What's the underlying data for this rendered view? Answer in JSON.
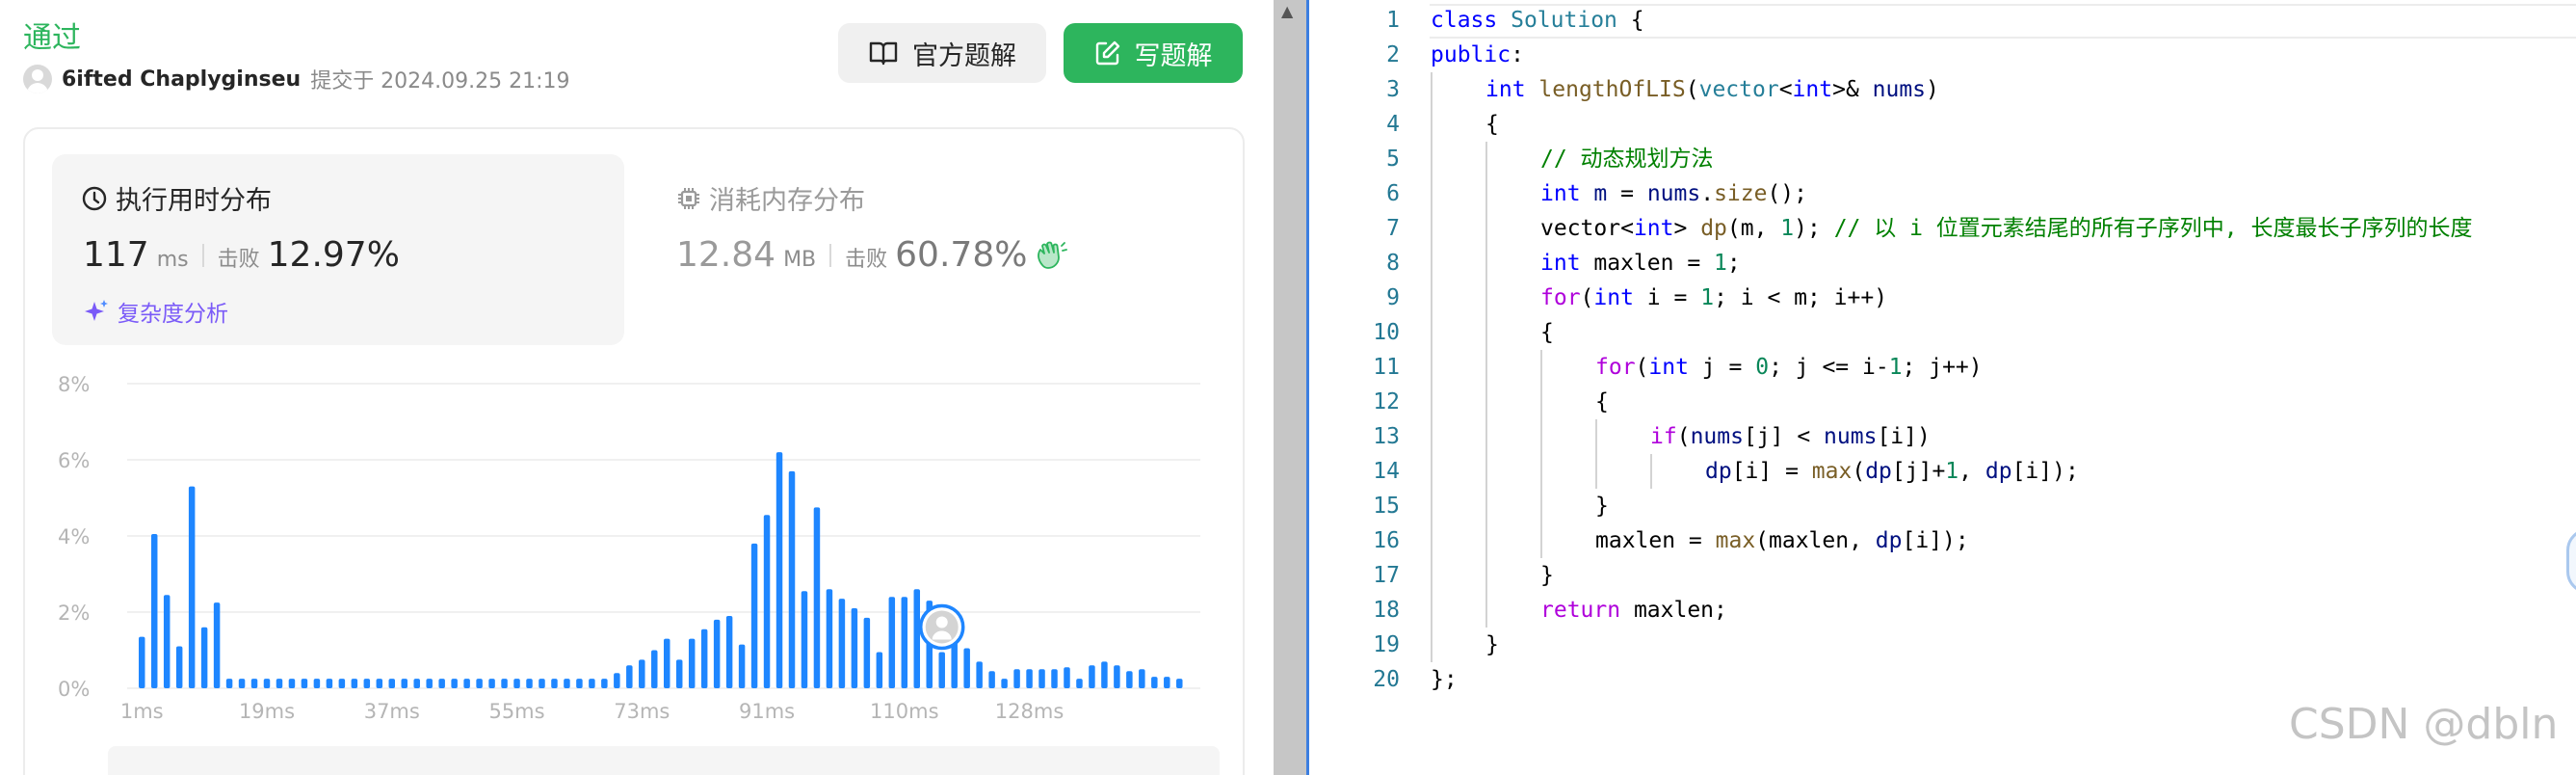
{
  "submission": {
    "status": "通过",
    "user": "6ifted Chaplyginseu",
    "submitted_text": "提交于 2024.09.25 21:19"
  },
  "buttons": {
    "official": "官方题解",
    "write": "写题解"
  },
  "runtime": {
    "title": "执行用时分布",
    "value": "117",
    "unit": "ms",
    "beat_label": "击败",
    "beat_pct": "12.97%",
    "analysis": "复杂度分析"
  },
  "memory": {
    "title": "消耗内存分布",
    "value": "12.84",
    "unit": "MB",
    "beat_label": "击败",
    "beat_pct": "60.78%"
  },
  "colors": {
    "accent_green": "#2db55d",
    "bar_blue": "#1e86ff",
    "analysis_purple": "#7a5af8"
  },
  "chart_data": {
    "type": "bar",
    "ylim": [
      0,
      8
    ],
    "y_ticks": [
      "0%",
      "2%",
      "4%",
      "6%",
      "8%"
    ],
    "x_ticks": [
      "1ms",
      "19ms",
      "37ms",
      "55ms",
      "73ms",
      "91ms",
      "110ms",
      "128ms"
    ],
    "values": [
      1.35,
      4.05,
      2.45,
      1.1,
      5.3,
      1.6,
      2.25,
      0.25,
      0.25,
      0.25,
      0.25,
      0.25,
      0.25,
      0.25,
      0.25,
      0.25,
      0.25,
      0.25,
      0.25,
      0.25,
      0.25,
      0.25,
      0.25,
      0.25,
      0.25,
      0.25,
      0.25,
      0.25,
      0.25,
      0.25,
      0.25,
      0.25,
      0.25,
      0.25,
      0.25,
      0.25,
      0.25,
      0.25,
      0.4,
      0.6,
      0.75,
      1.0,
      1.3,
      0.75,
      1.3,
      1.55,
      1.8,
      1.9,
      1.15,
      3.8,
      4.55,
      6.2,
      5.7,
      2.55,
      4.75,
      2.6,
      2.35,
      2.1,
      1.85,
      0.95,
      2.4,
      2.4,
      2.6,
      2.3,
      0.95,
      1.55,
      1.05,
      0.7,
      0.45,
      0.25,
      0.5,
      0.5,
      0.5,
      0.5,
      0.55,
      0.25,
      0.6,
      0.7,
      0.6,
      0.45,
      0.5,
      0.3,
      0.3,
      0.25
    ],
    "highlight_value": "117ms",
    "grid": true
  },
  "code": {
    "lines": [
      {
        "n": "1",
        "indent": 0,
        "tokens": [
          [
            "kw",
            "class"
          ],
          [
            "t",
            " "
          ],
          [
            "ty",
            "Solution"
          ],
          [
            "t",
            " {"
          ]
        ]
      },
      {
        "n": "2",
        "indent": 0,
        "tokens": [
          [
            "kw",
            "public"
          ],
          [
            "t",
            ":"
          ]
        ]
      },
      {
        "n": "3",
        "indent": 1,
        "tokens": [
          [
            "kw",
            "int"
          ],
          [
            "t",
            " "
          ],
          [
            "fn",
            "lengthOfLIS"
          ],
          [
            "t",
            "("
          ],
          [
            "ty",
            "vector"
          ],
          [
            "t",
            "<"
          ],
          [
            "kw",
            "int"
          ],
          [
            "t",
            ">& "
          ],
          [
            "vr",
            "nums"
          ],
          [
            "t",
            ")"
          ]
        ]
      },
      {
        "n": "4",
        "indent": 1,
        "tokens": [
          [
            "t",
            "{"
          ]
        ]
      },
      {
        "n": "5",
        "indent": 2,
        "tokens": [
          [
            "cm",
            "// 动态规划方法"
          ]
        ]
      },
      {
        "n": "6",
        "indent": 2,
        "tokens": [
          [
            "kw",
            "int"
          ],
          [
            "t",
            " "
          ],
          [
            "vr",
            "m"
          ],
          [
            "t",
            " = "
          ],
          [
            "vr",
            "nums"
          ],
          [
            "t",
            "."
          ],
          [
            "fn",
            "size"
          ],
          [
            "t",
            "();"
          ]
        ]
      },
      {
        "n": "7",
        "indent": 2,
        "tokens": [
          [
            "t",
            "vector<"
          ],
          [
            "kw",
            "int"
          ],
          [
            "t",
            "> "
          ],
          [
            "fn",
            "dp"
          ],
          [
            "t",
            "(m, "
          ],
          [
            "nu",
            "1"
          ],
          [
            "t",
            "); "
          ],
          [
            "cm",
            "// 以 i 位置元素结尾的所有子序列中, 长度最长子序列的长度"
          ]
        ]
      },
      {
        "n": "8",
        "indent": 2,
        "tokens": [
          [
            "kw",
            "int"
          ],
          [
            "t",
            " maxlen = "
          ],
          [
            "nu",
            "1"
          ],
          [
            "t",
            ";"
          ]
        ]
      },
      {
        "n": "9",
        "indent": 2,
        "tokens": [
          [
            "ctl",
            "for"
          ],
          [
            "t",
            "("
          ],
          [
            "kw",
            "int"
          ],
          [
            "t",
            " i = "
          ],
          [
            "nu",
            "1"
          ],
          [
            "t",
            "; i < m; i++)"
          ]
        ]
      },
      {
        "n": "10",
        "indent": 2,
        "tokens": [
          [
            "t",
            "{"
          ]
        ]
      },
      {
        "n": "11",
        "indent": 3,
        "tokens": [
          [
            "ctl",
            "for"
          ],
          [
            "t",
            "("
          ],
          [
            "kw",
            "int"
          ],
          [
            "t",
            " j = "
          ],
          [
            "nu",
            "0"
          ],
          [
            "t",
            "; j <= i-"
          ],
          [
            "nu",
            "1"
          ],
          [
            "t",
            "; j++)"
          ]
        ]
      },
      {
        "n": "12",
        "indent": 3,
        "tokens": [
          [
            "t",
            "{"
          ]
        ]
      },
      {
        "n": "13",
        "indent": 4,
        "tokens": [
          [
            "ctl",
            "if"
          ],
          [
            "t",
            "("
          ],
          [
            "vr",
            "nums"
          ],
          [
            "t",
            "[j] < "
          ],
          [
            "vr",
            "nums"
          ],
          [
            "t",
            "[i])"
          ]
        ]
      },
      {
        "n": "14",
        "indent": 5,
        "tokens": [
          [
            "vr",
            "dp"
          ],
          [
            "t",
            "[i] = "
          ],
          [
            "fn",
            "max"
          ],
          [
            "t",
            "("
          ],
          [
            "vr",
            "dp"
          ],
          [
            "t",
            "[j]+"
          ],
          [
            "nu",
            "1"
          ],
          [
            "t",
            ", "
          ],
          [
            "vr",
            "dp"
          ],
          [
            "t",
            "[i]);"
          ]
        ]
      },
      {
        "n": "15",
        "indent": 3,
        "tokens": [
          [
            "t",
            "}"
          ]
        ]
      },
      {
        "n": "16",
        "indent": 3,
        "tokens": [
          [
            "t",
            "maxlen = "
          ],
          [
            "fn",
            "max"
          ],
          [
            "t",
            "(maxlen, "
          ],
          [
            "vr",
            "dp"
          ],
          [
            "t",
            "[i]);"
          ]
        ]
      },
      {
        "n": "17",
        "indent": 2,
        "tokens": [
          [
            "t",
            "}"
          ]
        ]
      },
      {
        "n": "18",
        "indent": 2,
        "tokens": [
          [
            "ctl",
            "return"
          ],
          [
            "t",
            " maxlen;"
          ]
        ]
      },
      {
        "n": "19",
        "indent": 1,
        "tokens": [
          [
            "t",
            "}"
          ]
        ]
      },
      {
        "n": "20",
        "indent": 0,
        "tokens": [
          [
            "t",
            "};"
          ]
        ]
      }
    ]
  },
  "watermark": "CSDN @dbln"
}
